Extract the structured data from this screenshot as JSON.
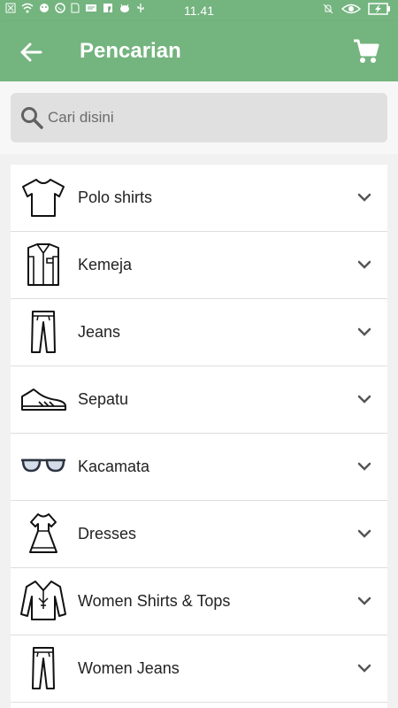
{
  "status_bar": {
    "time": "11.41",
    "icons": [
      "close-box-icon",
      "wifi-icon",
      "android-icon",
      "whatsapp-icon",
      "sim-icon",
      "message-icon",
      "facebook-icon",
      "android-head-icon",
      "usb-icon",
      "mute-icon",
      "eye-icon",
      "battery-charging-icon"
    ]
  },
  "app_bar": {
    "title": "Pencarian",
    "back_icon": "arrow-left-icon",
    "cart_icon": "cart-icon"
  },
  "search": {
    "placeholder": "Cari disini",
    "icon": "search-icon"
  },
  "categories": [
    {
      "label": "Polo shirts",
      "icon": "tshirt-icon"
    },
    {
      "label": "Kemeja",
      "icon": "shirt-icon"
    },
    {
      "label": "Jeans",
      "icon": "jeans-icon"
    },
    {
      "label": "Sepatu",
      "icon": "sneaker-icon"
    },
    {
      "label": "Kacamata",
      "icon": "glasses-icon"
    },
    {
      "label": "Dresses",
      "icon": "dress-icon"
    },
    {
      "label": "Women Shirts & Tops",
      "icon": "blouse-icon"
    },
    {
      "label": "Women Jeans",
      "icon": "women-jeans-icon"
    }
  ],
  "colors": {
    "primary": "#74b47f",
    "search_bg": "#e0e0e0"
  }
}
